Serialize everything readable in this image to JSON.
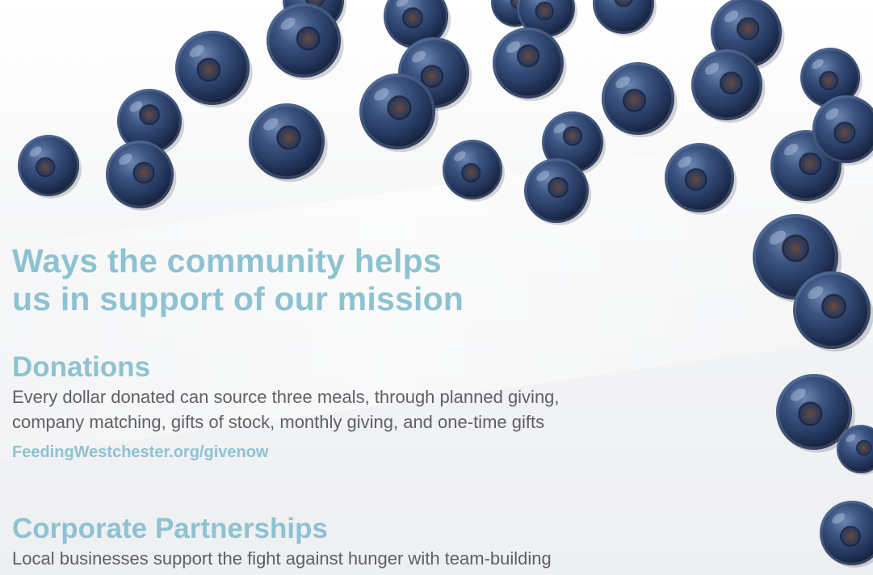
{
  "headline": "Ways the community helps\nus in support of our mission",
  "sections": [
    {
      "title": "Donations",
      "body": "Every dollar donated can source three meals, through planned giving,\ncompany matching, gifts of stock, monthly giving, and one-time gifts",
      "link": "FeedingWestchester.org/givenow"
    },
    {
      "title": "Corporate Partnerships",
      "body": "Local businesses support the fight against hunger with team-building"
    }
  ],
  "colors": {
    "accent": "#8ec2d1",
    "body_text": "#5e6064",
    "berry": "#2e4166"
  },
  "decoration": "blueberry-icon"
}
